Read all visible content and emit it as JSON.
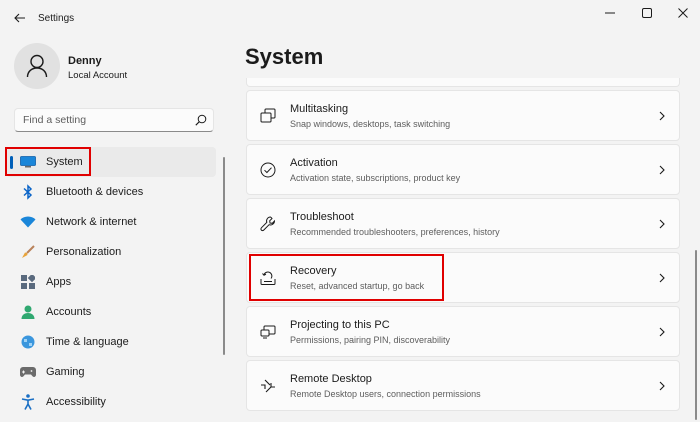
{
  "window": {
    "title": "Settings"
  },
  "profile": {
    "name": "Denny",
    "account_type": "Local Account"
  },
  "search": {
    "placeholder": "Find a setting"
  },
  "nav": {
    "items": [
      {
        "label": "System",
        "icon": "system-icon",
        "active": true
      },
      {
        "label": "Bluetooth & devices",
        "icon": "bluetooth-icon"
      },
      {
        "label": "Network & internet",
        "icon": "wifi-icon"
      },
      {
        "label": "Personalization",
        "icon": "brush-icon"
      },
      {
        "label": "Apps",
        "icon": "apps-icon"
      },
      {
        "label": "Accounts",
        "icon": "accounts-icon"
      },
      {
        "label": "Time & language",
        "icon": "globe-icon"
      },
      {
        "label": "Gaming",
        "icon": "gamepad-icon"
      },
      {
        "label": "Accessibility",
        "icon": "accessibility-icon"
      }
    ]
  },
  "main": {
    "title": "System",
    "cards": [
      {
        "title": "Multitasking",
        "subtitle": "Snap windows, desktops, task switching",
        "icon": "multitasking-icon"
      },
      {
        "title": "Activation",
        "subtitle": "Activation state, subscriptions, product key",
        "icon": "activation-icon"
      },
      {
        "title": "Troubleshoot",
        "subtitle": "Recommended troubleshooters, preferences, history",
        "icon": "wrench-icon"
      },
      {
        "title": "Recovery",
        "subtitle": "Reset, advanced startup, go back",
        "icon": "recovery-icon"
      },
      {
        "title": "Projecting to this PC",
        "subtitle": "Permissions, pairing PIN, discoverability",
        "icon": "projecting-icon"
      },
      {
        "title": "Remote Desktop",
        "subtitle": "Remote Desktop users, connection permissions",
        "icon": "remote-desktop-icon"
      }
    ]
  },
  "colors": {
    "accent": "#005fb8",
    "highlight": "#e00000"
  }
}
